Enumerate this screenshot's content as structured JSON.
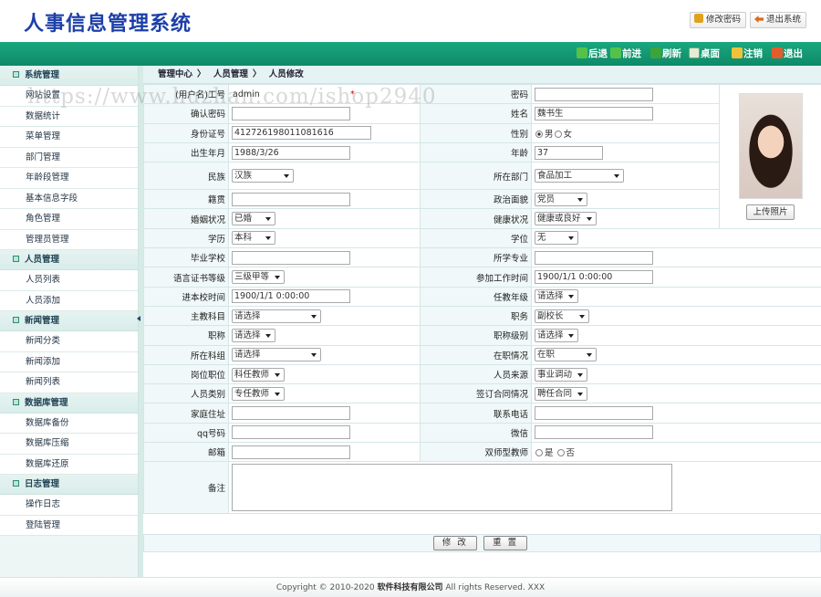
{
  "app": {
    "title": "人事信息管理系统"
  },
  "topbar": {
    "change_password": "修改密码",
    "logout": "退出系统"
  },
  "nav": {
    "back": "后退",
    "forward": "前进",
    "refresh": "刷新",
    "desktop": "桌面",
    "signout": "注销",
    "quit": "退出"
  },
  "sidebar": [
    {
      "group": "系统管理",
      "items": [
        "网站设置",
        "数据统计",
        "菜单管理",
        "部门管理",
        "年龄段管理",
        "基本信息字段",
        "角色管理",
        "管理员管理"
      ]
    },
    {
      "group": "人员管理",
      "items": [
        "人员列表",
        "人员添加"
      ]
    },
    {
      "group": "新闻管理",
      "items": [
        "新闻分类",
        "新闻添加",
        "新闻列表"
      ]
    },
    {
      "group": "数据库管理",
      "items": [
        "数据库备份",
        "数据库压缩",
        "数据库还原"
      ]
    },
    {
      "group": "日志管理",
      "items": [
        "操作日志",
        "登陆管理"
      ]
    }
  ],
  "breadcrumb": [
    "管理中心",
    "人员管理",
    "人员修改"
  ],
  "watermark": "https://www.huzhan.com/ishop2940",
  "form": {
    "username_label": "(用户名)工号",
    "username": "admin",
    "required_mark": "*",
    "password_label": "密码",
    "password": "",
    "confirm_label": "确认密码",
    "confirm": "",
    "name_label": "姓名",
    "name": "魏书生",
    "idcard_label": "身份证号",
    "idcard": "412726198011081616",
    "gender_label": "性别",
    "gender_male": "男",
    "gender_female": "女",
    "birth_label": "出生年月",
    "birth": "1988/3/26",
    "age_label": "年龄",
    "age": "37",
    "nation_label": "民族",
    "nation": "汉族",
    "dept_label": "所在部门",
    "dept": "食品加工",
    "origin_label": "籍贯",
    "origin": "",
    "politics_label": "政治面貌",
    "politics": "党员",
    "marriage_label": "婚姻状况",
    "marriage": "已婚",
    "health_label": "健康状况",
    "health": "健康或良好",
    "edu_label": "学历",
    "edu": "本科",
    "degree_label": "学位",
    "degree": "无",
    "school_label": "毕业学校",
    "school": "",
    "major_label": "所学专业",
    "major": "",
    "lang_label": "语言证书等级",
    "lang": "三级甲等",
    "workstart_label": "参加工作时间",
    "workstart": "1900/1/1 0:00:00",
    "joinschool_label": "进本校时间",
    "joinschool": "1900/1/1 0:00:00",
    "grade_label": "任教年级",
    "grade": "请选择",
    "subject_label": "主教科目",
    "subject": "请选择",
    "duty_label": "职务",
    "duty": "副校长",
    "title_label": "职称",
    "title": "请选择",
    "title_level_label": "职称级别",
    "title_level": "请选择",
    "group_label": "所在科组",
    "group": "请选择",
    "status_label": "在职情况",
    "status": "在职",
    "post_label": "岗位职位",
    "post": "科任教师",
    "source_label": "人员来源",
    "source": "事业调动",
    "category_label": "人员类别",
    "category": "专任教师",
    "contract_label": "签订合同情况",
    "contract": "聘任合同",
    "address_label": "家庭住址",
    "address": "",
    "phone_label": "联系电话",
    "phone": "",
    "qq_label": "qq号码",
    "qq": "",
    "wechat_label": "微信",
    "wechat": "",
    "email_label": "邮箱",
    "email": "",
    "dual_label": "双师型教师",
    "dual_yes": "是",
    "dual_no": "否",
    "remark_label": "备注",
    "remark": "",
    "upload_label": "上传照片"
  },
  "buttons": {
    "submit": "修 改",
    "reset": "重 置"
  },
  "footer": {
    "prefix": "Copyright © 2010-2020",
    "company": "软件科技有限公司",
    "suffix": "All rights Reserved. XXX"
  }
}
